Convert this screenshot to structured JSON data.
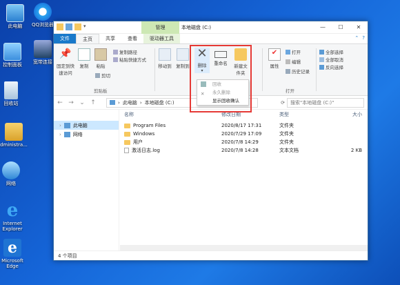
{
  "desktop": {
    "icons": [
      {
        "label": "此电脑"
      },
      {
        "label": "QQ浏览器"
      },
      {
        "label": "控制面板"
      },
      {
        "label": "宽带连接"
      },
      {
        "label": "回收站"
      },
      {
        "label": "dministra..."
      },
      {
        "label": "网络"
      },
      {
        "label": "Internet Explorer"
      },
      {
        "label": "Microsoft Edge"
      }
    ]
  },
  "window": {
    "context_tab": "管理",
    "title": "本地磁盘 (C:)",
    "tabs": [
      "文件",
      "主页",
      "共享",
      "查看",
      "驱动器工具"
    ],
    "ribbon": {
      "pin_label": "固定到快速访问",
      "copy_label": "复制",
      "paste_label": "粘贴",
      "copy_path": "复制路径",
      "paste_shortcut": "粘贴快捷方式",
      "cut": "剪切",
      "clipboard_group": "剪贴板",
      "move_to": "移动到",
      "copy_to": "复制到",
      "delete": "删除",
      "rename": "重命名",
      "new_folder": "新建文件夹",
      "properties": "属性",
      "open": "打开",
      "edit": "编辑",
      "history": "历史记录",
      "open_group": "打开",
      "select_all": "全部选择",
      "select_none": "全部取消",
      "invert_select": "反向选择"
    },
    "delete_menu": {
      "items": [
        "回收",
        "永久删除",
        "显示回收确认"
      ]
    },
    "address": {
      "parts": [
        "此电脑",
        "本地磁盘 (C:)"
      ],
      "search_placeholder": "搜索\"本地磁盘 (C:)\""
    },
    "nav_pane": {
      "items": [
        "此电脑",
        "网络"
      ]
    },
    "columns": {
      "name": "名称",
      "date": "修改日期",
      "type": "类型",
      "size": "大小"
    },
    "files": [
      {
        "name": "Program Files",
        "date": "2020/8/17 17:31",
        "type": "文件夹",
        "size": ""
      },
      {
        "name": "Windows",
        "date": "2020/7/29 17:09",
        "type": "文件夹",
        "size": ""
      },
      {
        "name": "用户",
        "date": "2020/7/8 14:29",
        "type": "文件夹",
        "size": ""
      },
      {
        "name": "激活日志.log",
        "date": "2020/7/8 14:28",
        "type": "文本文档",
        "size": "2 KB"
      }
    ],
    "status": "4 个项目"
  },
  "colors": {
    "accent": "#1979ca",
    "highlight": "#e53935",
    "context_tab": "#cde8b4"
  }
}
